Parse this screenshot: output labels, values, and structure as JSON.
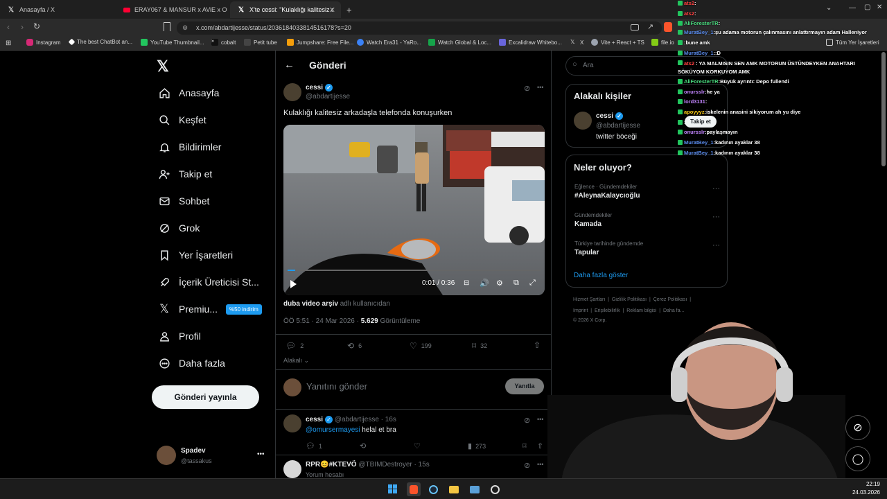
{
  "browser": {
    "tabs": [
      {
        "label": "Anasayfa / X",
        "icon": "x-logo-icon"
      },
      {
        "label": "ERAY067 & MANSUR x AViE x ORGAN",
        "icon": "youtube-icon"
      },
      {
        "label": "X'te cessi: \"Kulaklığı kalitesiz arka",
        "icon": "x-logo-icon"
      }
    ],
    "new_tab": "+",
    "url": "x.com/abdartijesse/status/2036184033814516178?s=20",
    "window_controls": {
      "minimize": "—",
      "maximize": "▢",
      "close": "✕"
    },
    "bookmarks": [
      "Instagram",
      "The best ChatBot an...",
      "YouTube Thumbnail...",
      "cobalt",
      "Petit tube",
      "Jumpshare: Free File...",
      "Watch Era31 - YaRo...",
      "Watch Global & Loc...",
      "Excalidraw Whitebo...",
      "X",
      "Vite + React + TS",
      "file.io"
    ],
    "bookmarks_extra": "Tüm Yer İşaretleri"
  },
  "nav": {
    "items": [
      {
        "label": "Anasayfa",
        "icon": "home-icon"
      },
      {
        "label": "Keşfet",
        "icon": "search-icon"
      },
      {
        "label": "Bildirimler",
        "icon": "bell-icon"
      },
      {
        "label": "Takip et",
        "icon": "add-user-icon"
      },
      {
        "label": "Sohbet",
        "icon": "mail-icon"
      },
      {
        "label": "Grok",
        "icon": "grok-icon"
      },
      {
        "label": "Yer İşaretleri",
        "icon": "bookmark-icon"
      },
      {
        "label": "İçerik Üreticisi St...",
        "icon": "rocket-icon"
      },
      {
        "label": "Premiu...",
        "icon": "x-logo-icon"
      },
      {
        "label": "Profil",
        "icon": "person-icon"
      },
      {
        "label": "Daha fazla",
        "icon": "more-icon"
      }
    ],
    "premium_badge": "%50 indirim",
    "post_button": "Gönderi yayınla",
    "account": {
      "name": "Spadev",
      "handle": "@tassakus"
    }
  },
  "post": {
    "header_title": "Gönderi",
    "author": "cessi",
    "handle": "@abdartijesse",
    "text": "Kulaklığı kalitesiz arkadaşla telefonda konuşurken",
    "video": {
      "time": "0:01 / 0:36",
      "progress": 0.03
    },
    "source_name": "duba video arşiv",
    "source_suffix": "adlı kullanıcıdan",
    "time": "ÖÖ 5:51 · 24 Mar 2026 · ",
    "views": "5.629",
    "views_label": "Görüntüleme",
    "stats": {
      "replies": "2",
      "reposts": "6",
      "likes": "199",
      "bookmarks": "32"
    },
    "relevance": "Alakalı",
    "reply_placeholder": "Yanıtını gönder",
    "reply_button": "Yanıtla"
  },
  "replies": [
    {
      "author": "cessi",
      "handle": "@abdartijesse · 16s",
      "mention": "@omursermayesi",
      "text": " helal et bra",
      "stats": {
        "replies": "1",
        "views": "273"
      }
    },
    {
      "author": "RPR😊#KTEVÖ",
      "handle": "@TBIMDestroyer · 15s",
      "text": "Yorum hesabı"
    }
  ],
  "sidebar": {
    "search_placeholder": "Ara",
    "related_title": "Alakalı kişiler",
    "related_person": {
      "name": "cessi",
      "handle": "@abdartijesse",
      "bio": "twitter böceği",
      "follow": "Takip et"
    },
    "trends_title": "Neler oluyor?",
    "trends": [
      {
        "category": "Eğlence · Gündemdekiler",
        "title": "#AleynaKalaycıoğlu"
      },
      {
        "category": "Gündemdekiler",
        "title": "Kamada"
      },
      {
        "category": "Türkiye tarihinde gündemde",
        "title": "Tapular"
      }
    ],
    "show_more": "Daha fazla göster",
    "footer": [
      "Hizmet Şartları",
      "Gizlilik Politikası",
      "Çerez Politikası",
      "Imprint",
      "Erişilebilirlik",
      "Reklam bilgisi",
      "Daha fa..."
    ],
    "copyright": "© 2026 X Corp."
  },
  "chat": [
    {
      "user": "ats2",
      "msg": "",
      "color": "#ff4040"
    },
    {
      "user": "ats2",
      "msg": "",
      "color": "#ff4040"
    },
    {
      "user": "AliForesterTR",
      "msg": "",
      "color": "#4ade80"
    },
    {
      "user": "MuratBey_1",
      "msg": "şu adama motorun çalınmasını anlattırmayın adam Halleniyor",
      "color": "#5b8def"
    },
    {
      "user": "",
      "msg": "bune amk",
      "color": "#5b8def"
    },
    {
      "user": "MuratBey_1",
      "msg": ":D",
      "color": "#5b8def"
    },
    {
      "user": "ats2",
      "msg": "YA MALMISIN SEN AMK MOTORUN ÜSTÜNDEYKEN ANAHTARI SÖKÜYOM KORKUYOM AMK",
      "color": "#ff4040"
    },
    {
      "user": "AliForesterTR",
      "msg": "Büyük ayrıntı: Depo fullendi",
      "color": "#4ade80"
    },
    {
      "user": "onursslr",
      "msg": "he ya",
      "color": "#c084fc"
    },
    {
      "user": "lord3131",
      "msg": "",
      "color": "#c084fc"
    },
    {
      "user": "apoyyyz",
      "msg": "iskelenin anasini sikiyorum ah yu diye",
      "color": "#facc15"
    },
    {
      "user": "",
      "msg": "",
      "color": "#5b8def"
    },
    {
      "user": "onursslr",
      "msg": "paylaşmayın",
      "color": "#c084fc"
    },
    {
      "user": "MuratBey_1",
      "msg": "kadının ayaklar 38",
      "color": "#5b8def"
    },
    {
      "user": "MuratBey_1",
      "msg": "kadının ayaklar 38",
      "color": "#5b8def"
    }
  ],
  "taskbar": {
    "time": "22:19",
    "date": "24.03.2026"
  }
}
